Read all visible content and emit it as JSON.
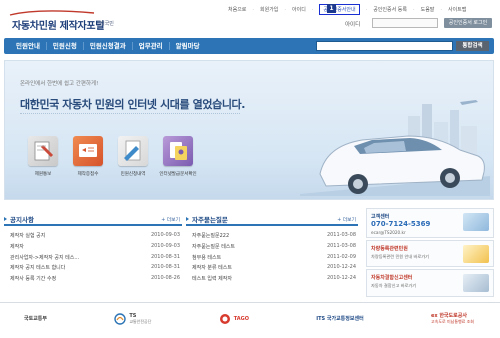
{
  "header": {
    "logo_title": "자동차민원 제작자포털",
    "logo_sub": "대국민",
    "util_links": [
      "처음으로",
      "회원가입",
      "아이디",
      "공인인증서안내",
      "공인인증서 등록",
      "도움말",
      "사이트맵"
    ],
    "badge": "1",
    "login_label": "아이디",
    "login_button": "공인인증서 로그인"
  },
  "nav": {
    "items": [
      "민원안내",
      "민원신청",
      "민원신청결과",
      "업무관리",
      "알림마당"
    ],
    "search_button": "통합검색"
  },
  "hero": {
    "small": "온라인에서 한번에 쉽고 간편하게!",
    "title": "대한민국 자동차 민원의 인터넷 시대를 열었습니다.",
    "quick_links": [
      {
        "label": "제원통보",
        "icon": "car-spec-icon",
        "color": "#c94a3a"
      },
      {
        "label": "제작증접수",
        "icon": "certificate-icon",
        "color": "#d9642f"
      },
      {
        "label": "민원신청내역",
        "icon": "document-list-icon",
        "color": "#3f8bc9"
      },
      {
        "label": "인터넷발급문서확인",
        "icon": "verify-document-icon",
        "color": "#7a5bb0"
      }
    ]
  },
  "notice": {
    "title": "공지사항",
    "more": "+ 더보기",
    "rows": [
      {
        "title": "제작자 실험 공지",
        "date": "2010-09-03"
      },
      {
        "title": "제작자",
        "date": "2010-09-03"
      },
      {
        "title": "관리사업자->제작자 공지 테스...",
        "date": "2010-08-31"
      },
      {
        "title": "제작자 공지 테스트 합니다",
        "date": "2010-08-31"
      },
      {
        "title": "제작사 등록 기간 수정",
        "date": "2010-08-26"
      }
    ]
  },
  "faq": {
    "title": "자주묻는질문",
    "more": "+ 더보기",
    "rows": [
      {
        "title": "자주묻는질문222",
        "date": "2011-03-08"
      },
      {
        "title": "자주묻는질문 테스트",
        "date": "2011-03-08"
      },
      {
        "title": "첨부용 테스트",
        "date": "2011-02-09"
      },
      {
        "title": "제작자 분류 테스트",
        "date": "2010-12-24"
      },
      {
        "title": "테스트 입력 제작자",
        "date": "2010-12-24"
      }
    ]
  },
  "side": {
    "callcenter_head": "고객센터",
    "callcenter_phone": "070-7124-5369",
    "callcenter_mail": "ecar@TS2020.kr",
    "reg_head": "차량등록관련민원",
    "reg_desc": "차량등록관련 민원 안내 바로가기",
    "defect_head": "자동차결함신고센터",
    "defect_desc": "자동차 결함신고 바로가기"
  },
  "footer": {
    "logos": [
      {
        "name": "국토교통부",
        "sub": ""
      },
      {
        "name": "TS",
        "sub": "교통안전공단"
      },
      {
        "name": "TAGO",
        "sub": ""
      },
      {
        "name": "ITS 국가교통정보센터",
        "sub": ""
      },
      {
        "name": "ex 한국도로공사",
        "sub": "고속도로 미납통행료 조회"
      }
    ]
  },
  "colors": {
    "brand_blue": "#2c74b5",
    "highlight_border": "#1a2fd1"
  }
}
